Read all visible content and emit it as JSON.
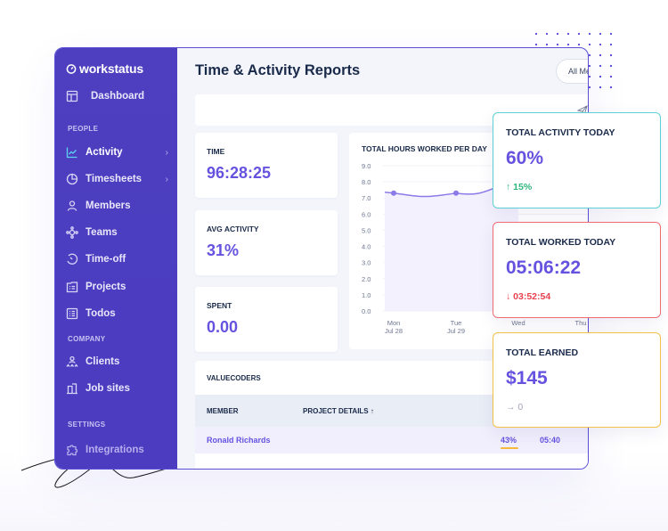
{
  "app": {
    "logo": "workstatus",
    "page_title": "Time & Activity Reports",
    "member_filter": "All Members"
  },
  "sidebar": {
    "dashboard": "Dashboard",
    "sections": {
      "people": "PEOPLE",
      "company": "COMPANY",
      "settings": "SETTINGS"
    },
    "people_items": [
      {
        "label": "Activity",
        "icon": "activity-chart-icon",
        "active": true,
        "has_submenu": true
      },
      {
        "label": "Timesheets",
        "icon": "pie-clock-icon",
        "active": false,
        "has_submenu": true
      },
      {
        "label": "Members",
        "icon": "user-icon",
        "active": false,
        "has_submenu": false
      },
      {
        "label": "Teams",
        "icon": "teams-icon",
        "active": false,
        "has_submenu": false
      },
      {
        "label": "Time-off",
        "icon": "time-off-icon",
        "active": false,
        "has_submenu": false
      },
      {
        "label": "Projects",
        "icon": "projects-icon",
        "active": false,
        "has_submenu": false
      },
      {
        "label": "Todos",
        "icon": "todos-icon",
        "active": false,
        "has_submenu": false
      }
    ],
    "company_items": [
      {
        "label": "Clients",
        "icon": "clients-icon"
      },
      {
        "label": "Job sites",
        "icon": "job-sites-icon"
      }
    ],
    "settings_items": [
      {
        "label": "Integrations",
        "icon": "puzzle-icon"
      }
    ],
    "chevron": "›"
  },
  "stats": [
    {
      "label": "TIME",
      "value": "96:28:25"
    },
    {
      "label": "AVG ACTIVITY",
      "value": "31%"
    },
    {
      "label": "SPENT",
      "value": "0.00"
    }
  ],
  "chart_data": {
    "type": "line",
    "title": "TOTAL HOURS WORKED PER DAY",
    "xlabel": "",
    "ylabel": "",
    "ylim": [
      0,
      9
    ],
    "y_ticks": [
      "0.0",
      "1.0",
      "2.0",
      "3.0",
      "4.0",
      "5.0",
      "6.0",
      "7.0",
      "8.0",
      "9.0"
    ],
    "categories": [
      {
        "day": "Mon",
        "date": "Jul 28"
      },
      {
        "day": "Tue",
        "date": "Jul 29"
      },
      {
        "day": "Wed",
        "date": ""
      },
      {
        "day": "Thu",
        "date": ""
      }
    ],
    "series": [
      {
        "name": "Hours",
        "values": [
          7.3,
          7.3,
          8.0,
          null
        ],
        "color": "#8a7be8"
      }
    ],
    "grid": true,
    "area_fill": true
  },
  "table": {
    "company": "VALUECODERS",
    "columns": [
      "MEMBER",
      "PROJECT DETAILS ↑"
    ],
    "rows": [
      {
        "member": "Ronald Richards",
        "activity": "43%",
        "activity_fraction": 0.43,
        "time": "05:40"
      }
    ]
  },
  "cards": [
    {
      "label": "TOTAL ACTIVITY TODAY",
      "value": "60%",
      "delta": "↑ 15%",
      "delta_color": "#2eb67d",
      "border": "#5ecfd4"
    },
    {
      "label": "TOTAL WORKED TODAY",
      "value": "05:06:22",
      "delta": "↓ 03:52:54",
      "delta_color": "#e8414f",
      "border": "#ee6b74"
    },
    {
      "label": "TOTAL EARNED",
      "value": "$145",
      "delta": "→ 0",
      "delta_color": "#a0a6b8",
      "border": "#f5c04a"
    }
  ],
  "colors": {
    "sidebar": "#4d3fbf",
    "accent": "#6553e0",
    "title": "#1a2a4a"
  }
}
